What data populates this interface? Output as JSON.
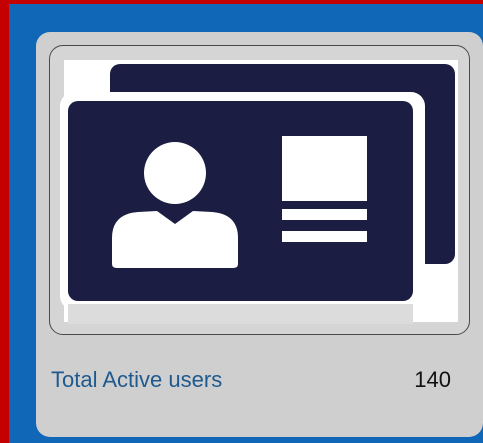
{
  "widget": {
    "title": "Total Active users",
    "count": "140",
    "icon": "id-card-icon"
  },
  "colors": {
    "background_blue": "#1067b8",
    "border_red": "#c40000",
    "card_gray": "#cfcfcf",
    "icon_navy": "#1b1e42",
    "title_blue": "#1f5a8e"
  }
}
